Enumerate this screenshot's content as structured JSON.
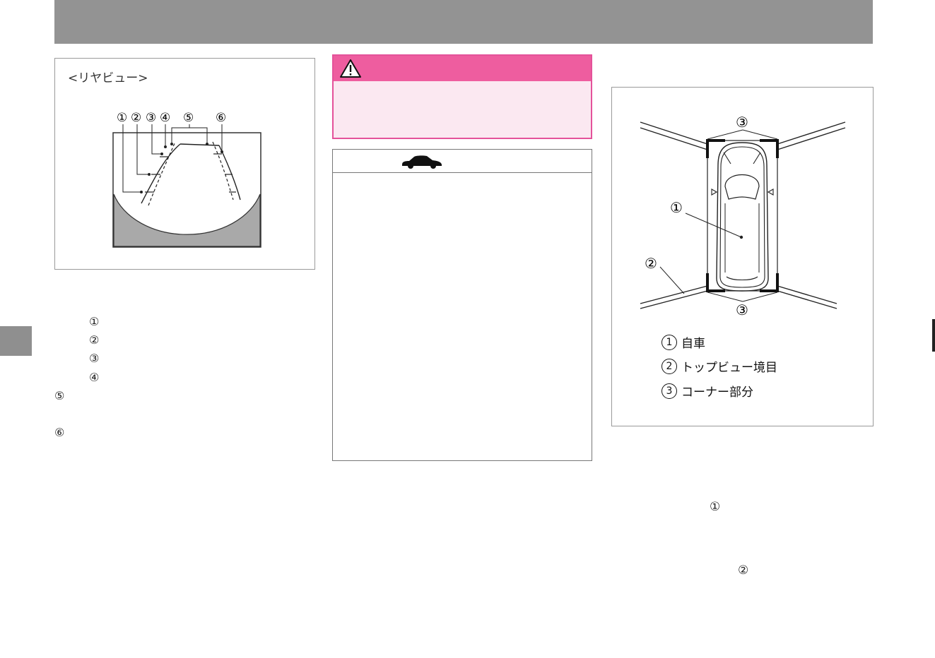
{
  "rear_view_figure": {
    "title": "<リヤビュー>",
    "callouts": [
      "①",
      "②",
      "③",
      "④",
      "⑤",
      "⑥"
    ]
  },
  "left_list": {
    "items": [
      "①",
      "②",
      "③",
      "④",
      "⑤",
      "⑥"
    ]
  },
  "top_view_figure": {
    "callouts": {
      "top": "③",
      "car": "①",
      "boundary": "②",
      "bottom": "③"
    },
    "legend": [
      {
        "num": "1",
        "label": "自車"
      },
      {
        "num": "2",
        "label": "トップビュー境目"
      },
      {
        "num": "3",
        "label": "コーナー部分"
      }
    ]
  },
  "right_text_markers": [
    "①",
    "②"
  ],
  "colors": {
    "header_bar": "#939393",
    "warning_pink": "#ee5d9f",
    "warning_bg": "#fbe8f1",
    "shade_gray": "#a9a9a9"
  },
  "icons": {
    "warning": "warning-triangle-icon",
    "vehicle": "car-icon"
  }
}
